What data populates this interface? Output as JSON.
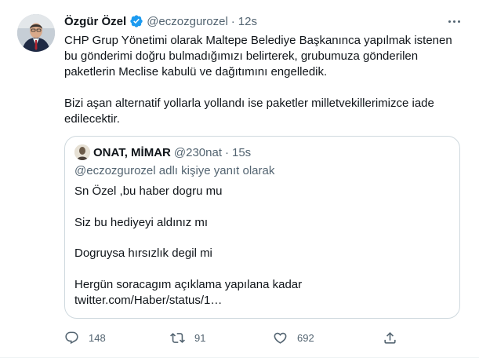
{
  "tweet": {
    "author_name": "Özgür Özel",
    "author_handle": "@eczozgurozel",
    "separator": "·",
    "time": "12s",
    "paragraphs": [
      "CHP Grup Yönetimi olarak Maltepe Belediye Başkanınca yapılmak istenen bu gönderimi doğru bulmadığımızı belirterek, grubumuza gönderilen paketlerin Meclise kabulü ve dağıtımını engelledik.",
      "Bizi aşan alternatif yollarla yollandı ise paketler milletvekillerimizce iade edilecektir."
    ]
  },
  "quoted": {
    "author_name": "ONAT, MİMAR",
    "author_handle": "@230nat",
    "separator": "·",
    "time": "15s",
    "replying_to": "@eczozgurozel adlı kişiye yanıt olarak",
    "lines": [
      "Sn Özel ,bu haber dogru mu",
      "Siz bu hediyeyi aldınız mı",
      "Dogruysa hırsızlık degil mi",
      "Hergün soracagım açıklama yapılana kadar",
      "twitter.com/Haber/status/1…"
    ]
  },
  "actions": {
    "reply_count": "148",
    "retweet_count": "91",
    "like_count": "692"
  },
  "icons": {
    "verified": "verified-badge-icon",
    "more": "more-dots-icon",
    "reply": "reply-icon",
    "retweet": "retweet-icon",
    "like": "like-icon",
    "share": "share-icon"
  },
  "colors": {
    "verified_blue": "#1d9bf0",
    "text_primary": "#0f1419",
    "text_secondary": "#536471",
    "border": "#cfd9de"
  }
}
